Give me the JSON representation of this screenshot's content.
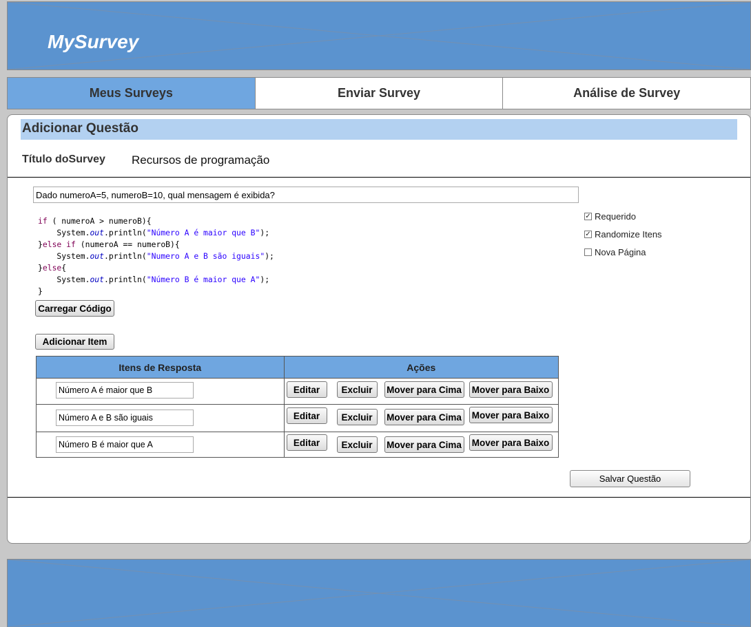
{
  "app": {
    "logo": "MySurvey"
  },
  "nav": {
    "tabs": [
      {
        "label": "Meus Surveys",
        "active": true
      },
      {
        "label": "Enviar Survey",
        "active": false
      },
      {
        "label": "Análise de Survey",
        "active": false
      }
    ]
  },
  "form": {
    "section_title": "Adicionar Questão",
    "survey_title_label": "Título doSurvey",
    "survey_title_value": "Recursos de programação",
    "question_text": "Dado numeroA=5, numeroB=10, qual mensagem é exibida?",
    "code_lines": [
      [
        {
          "t": "if",
          "c": "kw"
        },
        {
          "t": " ( numeroA > numeroB){"
        }
      ],
      [
        {
          "t": "    System."
        },
        {
          "t": "out",
          "c": "fld"
        },
        {
          "t": ".println("
        },
        {
          "t": "\"Número A é maior que B\"",
          "c": "str"
        },
        {
          "t": ");"
        }
      ],
      [
        {
          "t": "}"
        },
        {
          "t": "else if",
          "c": "kw"
        },
        {
          "t": " (numeroA == numeroB){"
        }
      ],
      [
        {
          "t": "    System."
        },
        {
          "t": "out",
          "c": "fld"
        },
        {
          "t": ".println("
        },
        {
          "t": "\"Numero A e B são iguais\"",
          "c": "str"
        },
        {
          "t": ");"
        }
      ],
      [
        {
          "t": "}"
        },
        {
          "t": "else",
          "c": "kw"
        },
        {
          "t": "{"
        }
      ],
      [
        {
          "t": "    System."
        },
        {
          "t": "out",
          "c": "fld"
        },
        {
          "t": ".println("
        },
        {
          "t": "\"Número B é maior que A\"",
          "c": "str"
        },
        {
          "t": ");"
        }
      ],
      [
        {
          "t": "}"
        }
      ]
    ],
    "load_code_button": "Carregar Código",
    "add_item_button": "Adicionar Item",
    "save_button": "Salvar Questão",
    "options": {
      "required": {
        "label": "Requerido",
        "checked": true
      },
      "randomize": {
        "label": "Randomize Itens",
        "checked": true
      },
      "new_page": {
        "label": "Nova Página",
        "checked": false
      }
    }
  },
  "items_table": {
    "col_items": "Itens de Resposta",
    "col_actions": "Ações",
    "actions": {
      "edit": "Editar",
      "delete": "Excluir",
      "move_up": "Mover para Cima",
      "move_down": "Mover para Baixo"
    },
    "rows": [
      {
        "value": "Número A é maior que B"
      },
      {
        "value": "Número A e B são iguais"
      },
      {
        "value": "Número B é maior que A"
      }
    ]
  }
}
